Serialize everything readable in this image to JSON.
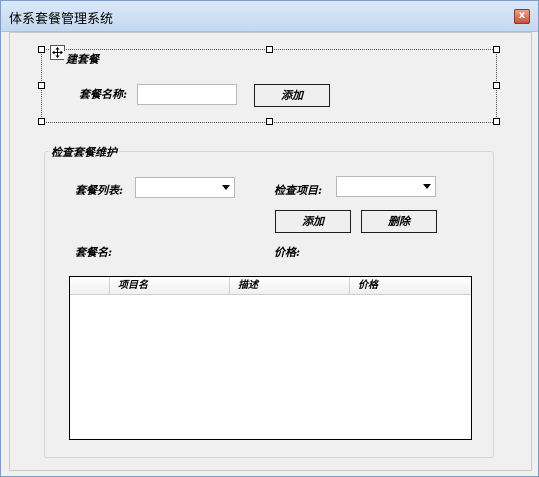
{
  "window": {
    "title": "体系套餐管理系统",
    "close_glyph": "x"
  },
  "create_group": {
    "title": "建套餐",
    "name_label": "套餐名称:",
    "name_value": "",
    "add_button": "添加"
  },
  "maintain_group": {
    "title": "检查套餐维护",
    "list_label": "套餐列表:",
    "list_selected": "",
    "item_label": "检查项目:",
    "item_selected": "",
    "add_button": "添加",
    "delete_button": "删除",
    "package_name_label": "套餐名:",
    "price_label": "价格:",
    "grid": {
      "columns": [
        "项目名",
        "描述",
        "价格"
      ],
      "rows": []
    }
  }
}
